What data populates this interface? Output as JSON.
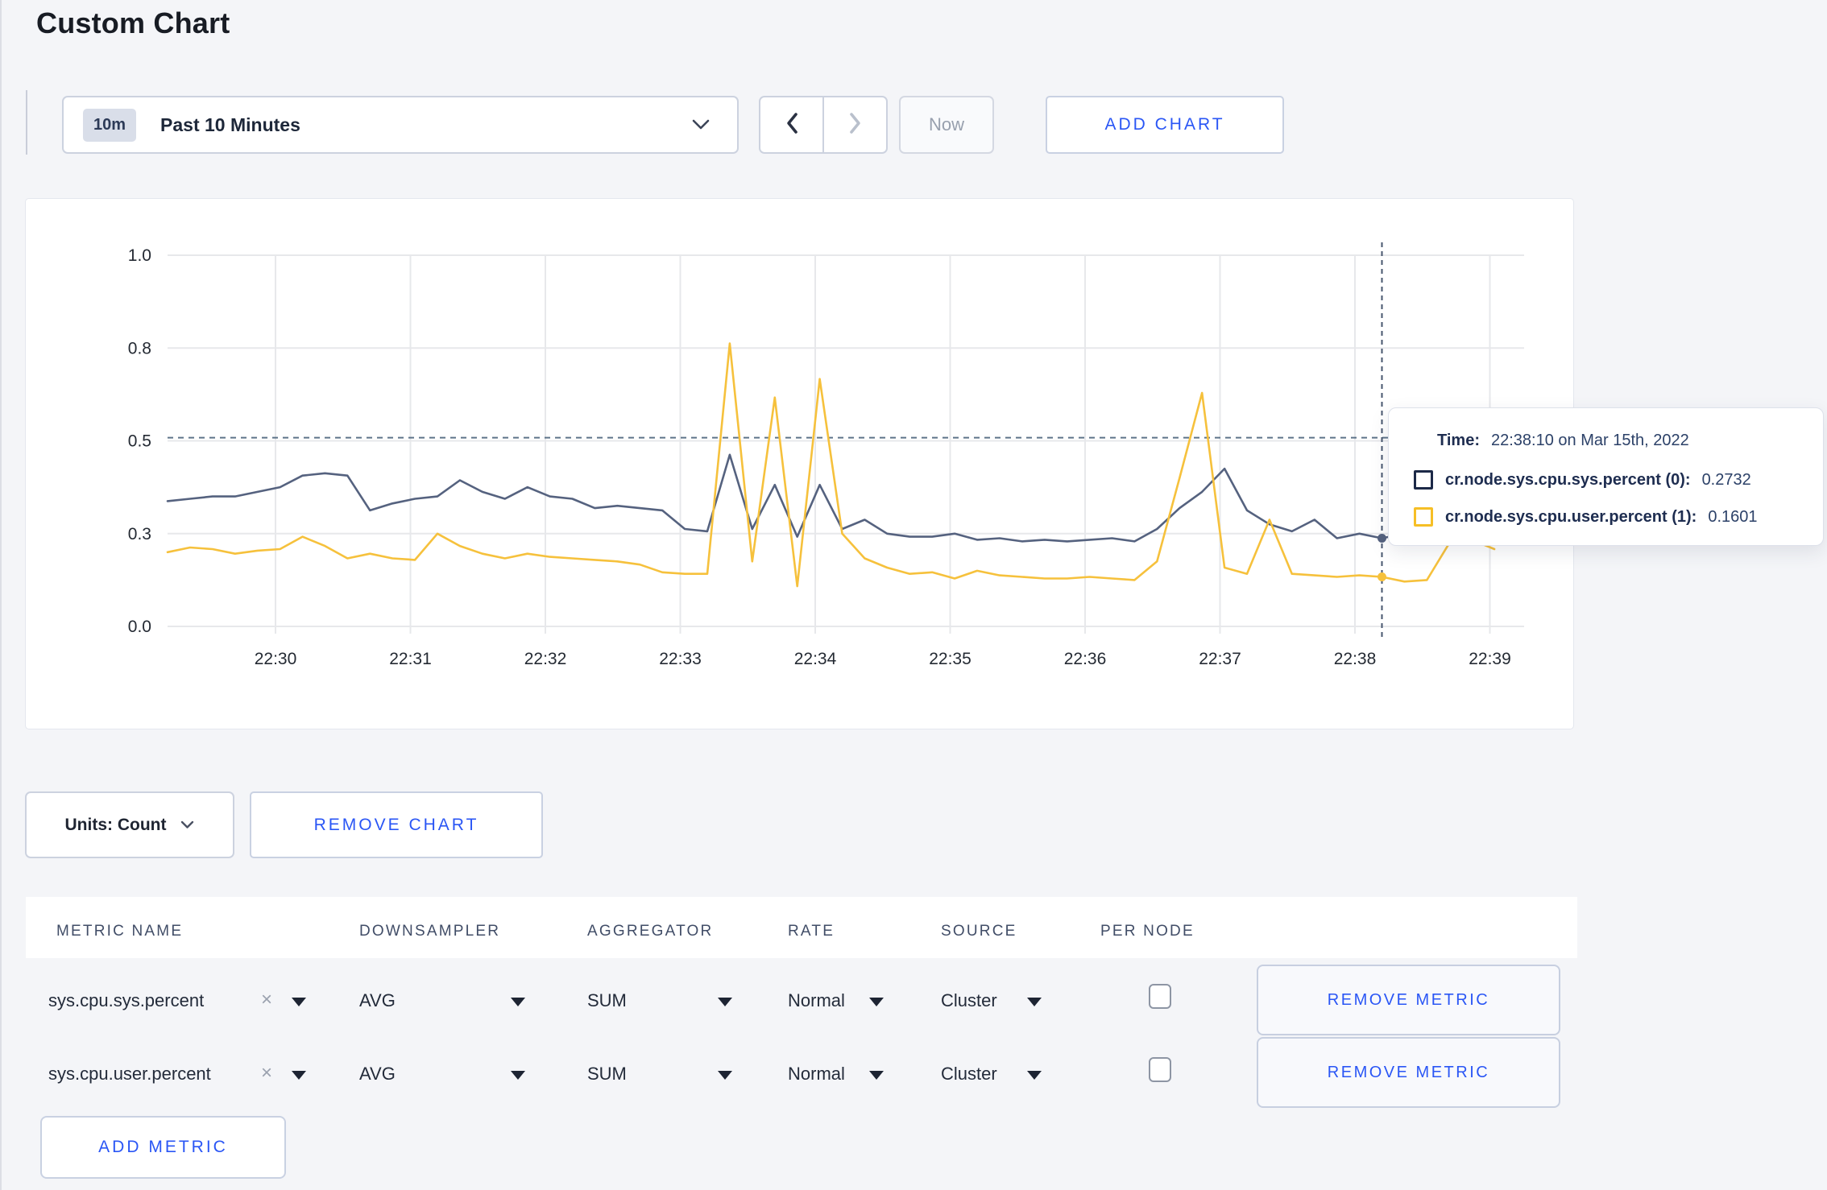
{
  "page": {
    "title": "Custom Chart"
  },
  "toolbar": {
    "time_badge": "10m",
    "time_label": "Past 10 Minutes",
    "now_label": "Now",
    "add_chart_label": "ADD CHART",
    "icons": [
      "chevron-down",
      "chevron-left",
      "chevron-right"
    ]
  },
  "chart_controls": {
    "units_label": "Units: Count",
    "remove_chart_label": "REMOVE CHART"
  },
  "tooltip": {
    "time_label": "Time:",
    "time_value": "22:38:10 on Mar 15th, 2022",
    "series": [
      {
        "label": "cr.node.sys.cpu.sys.percent (0):",
        "value": "0.2732",
        "swatch_color": "#1c2947"
      },
      {
        "label": "cr.node.sys.cpu.user.percent (1):",
        "value": "0.1601",
        "swatch_color": "#f6bf26"
      }
    ]
  },
  "chart_data": {
    "type": "line",
    "title": "",
    "xlabel": "",
    "ylabel": "",
    "grid": true,
    "y_ticks": [
      "0.0",
      "0.3",
      "0.5",
      "0.8",
      "1.0"
    ],
    "y_tick_values": [
      0,
      0.3,
      0.5,
      0.8,
      1.0
    ],
    "x_ticks": [
      "22:30",
      "22:31",
      "22:32",
      "22:33",
      "22:34",
      "22:35",
      "22:36",
      "22:37",
      "22:38",
      "22:39"
    ],
    "threshold_value": 0.51,
    "colors": {
      "grid": "#e7e8eb",
      "threshold": "#5d7389",
      "crosshair": "#47566e",
      "tick_text": "#242a33"
    },
    "crosshair": {
      "index": 54,
      "time": "22:38:10"
    },
    "series": [
      {
        "name": "cr.node.sys.cpu.sys.percent",
        "color": "#55627f",
        "x_start_min": -0.8,
        "x_step_min": 0.1666667,
        "values": [
          0.37,
          0.375,
          0.38,
          0.38,
          0.39,
          0.4,
          0.425,
          0.43,
          0.425,
          0.35,
          0.365,
          0.375,
          0.38,
          0.415,
          0.39,
          0.375,
          0.4,
          0.38,
          0.375,
          0.355,
          0.36,
          0.355,
          0.35,
          0.31,
          0.305,
          0.47,
          0.31,
          0.405,
          0.29,
          0.405,
          0.31,
          0.33,
          0.3,
          0.29,
          0.29,
          0.3,
          0.28,
          0.285,
          0.275,
          0.28,
          0.275,
          0.28,
          0.285,
          0.275,
          0.31,
          0.355,
          0.39,
          0.44,
          0.35,
          0.32,
          0.305,
          0.33,
          0.285,
          0.3,
          0.285,
          0.3,
          0.315,
          0.3,
          0.305,
          0.3
        ]
      },
      {
        "name": "cr.node.sys.cpu.user.percent",
        "color": "#f6c13c",
        "x_start_min": -0.8,
        "x_step_min": 0.1666667,
        "values": [
          0.24,
          0.255,
          0.25,
          0.235,
          0.245,
          0.25,
          0.29,
          0.26,
          0.22,
          0.235,
          0.22,
          0.215,
          0.3,
          0.26,
          0.235,
          0.22,
          0.235,
          0.225,
          0.22,
          0.215,
          0.21,
          0.2,
          0.175,
          0.17,
          0.17,
          0.81,
          0.21,
          0.64,
          0.13,
          0.7,
          0.3,
          0.22,
          0.19,
          0.17,
          0.175,
          0.155,
          0.18,
          0.165,
          0.16,
          0.155,
          0.155,
          0.16,
          0.155,
          0.15,
          0.21,
          0.42,
          0.655,
          0.19,
          0.17,
          0.33,
          0.17,
          0.165,
          0.16,
          0.165,
          0.1601,
          0.145,
          0.15,
          0.27,
          0.28,
          0.25
        ]
      }
    ]
  },
  "metrics_table": {
    "headers": [
      "METRIC NAME",
      "DOWNSAMPLER",
      "AGGREGATOR",
      "RATE",
      "SOURCE",
      "PER NODE"
    ],
    "rows": [
      {
        "metric": "sys.cpu.sys.percent",
        "remove_icon": "×",
        "downsampler": "AVG",
        "aggregator": "SUM",
        "rate": "Normal",
        "source": "Cluster",
        "per_node_checked": false,
        "remove_label": "REMOVE METRIC"
      },
      {
        "metric": "sys.cpu.user.percent",
        "remove_icon": "×",
        "downsampler": "AVG",
        "aggregator": "SUM",
        "rate": "Normal",
        "source": "Cluster",
        "per_node_checked": false,
        "remove_label": "REMOVE METRIC"
      }
    ],
    "add_metric_label": "ADD METRIC"
  }
}
